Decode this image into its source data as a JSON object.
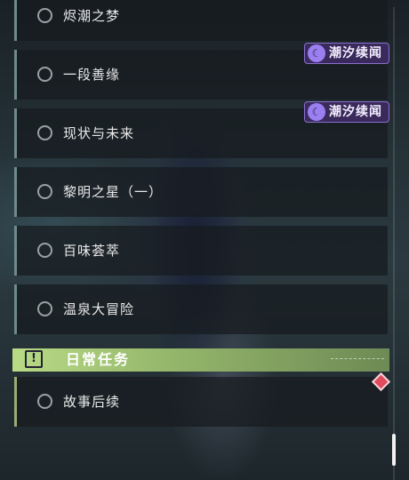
{
  "quests": [
    {
      "label": "烬潮之梦"
    },
    {
      "label": "一段善缘",
      "tag": "潮汐续闻"
    },
    {
      "label": "现状与未来",
      "tag": "潮汐续闻"
    },
    {
      "label": "黎明之星（一）"
    },
    {
      "label": "百味荟萃"
    },
    {
      "label": "温泉大冒险"
    }
  ],
  "section": {
    "icon_glyph": "!",
    "title": "日常任务"
  },
  "daily_quests": [
    {
      "label": "故事后续"
    }
  ],
  "tag_icon_glyph": "☾",
  "colors": {
    "section_accent": "#b9db86",
    "tag_bg": "#3a2a5c",
    "tag_border": "#8a6fd0",
    "alert_diamond": "#e24b5e"
  }
}
